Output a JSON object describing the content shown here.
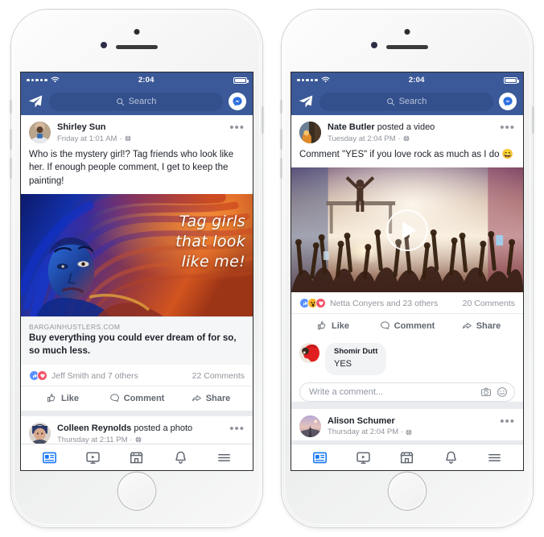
{
  "phones": [
    {
      "id": "phone-left",
      "status_bar": {
        "time": "2:04",
        "signal_dots": 5,
        "wifi": "wifi-icon",
        "battery": "battery-full-icon"
      },
      "nav_bar": {
        "left_icon": "paper-plane-icon",
        "search_placeholder": "Search",
        "search_icon": "search-icon",
        "right_icon": "messenger-icon"
      },
      "posts": [
        {
          "author": "Shirley Sun",
          "action": "",
          "timestamp": "Friday at 1:01 AM",
          "privacy_icon": "globe-icon",
          "menu_icon": "ellipsis-icon",
          "text": "Who is the mystery girl!? Tag friends who look like her. If enough people comment, I get to keep the painting!",
          "media_type": "image",
          "image_caption": "Tag girls\nthat look\nlike me!",
          "image_alt": "painting of a woman with flowing blue and orange hair",
          "link": {
            "domain": "BARGAINHUSTLERS.COM",
            "title": "Buy everything you could ever dream of for so, so much less."
          },
          "reactions": [
            "like",
            "love"
          ],
          "reaction_text": "Jeff Smith and 7 others",
          "comments_count": "22 Comments",
          "actions": [
            {
              "label": "Like",
              "icon": "thumbs-up-icon"
            },
            {
              "label": "Comment",
              "icon": "comment-bubble-icon"
            },
            {
              "label": "Share",
              "icon": "share-arrow-icon"
            }
          ]
        },
        {
          "author": "Colleen Reynolds",
          "action": "posted a photo",
          "timestamp": "Thursday at 2:11 PM",
          "privacy_icon": "globe-icon",
          "menu_icon": "ellipsis-icon"
        }
      ],
      "tab_bar": [
        {
          "name": "news-feed",
          "icon": "news-feed-icon",
          "active": true
        },
        {
          "name": "watch",
          "icon": "video-screen-icon",
          "active": false
        },
        {
          "name": "marketplace",
          "icon": "storefront-icon",
          "active": false
        },
        {
          "name": "notifications",
          "icon": "bell-icon",
          "active": false
        },
        {
          "name": "menu",
          "icon": "hamburger-menu-icon",
          "active": false
        }
      ]
    },
    {
      "id": "phone-right",
      "status_bar": {
        "time": "2:04",
        "signal_dots": 5,
        "wifi": "wifi-icon",
        "battery": "battery-full-icon"
      },
      "nav_bar": {
        "left_icon": "paper-plane-icon",
        "search_placeholder": "Search",
        "search_icon": "search-icon",
        "right_icon": "messenger-icon"
      },
      "posts": [
        {
          "author": "Nate Butler",
          "action": "posted a video",
          "timestamp": "Tuesday at 2:04 PM",
          "privacy_icon": "globe-icon",
          "menu_icon": "ellipsis-icon",
          "text": "Comment \"YES\" if you love rock as much as I do 😄",
          "media_type": "video",
          "video_alt": "concert crowd with raised hands and stage lights",
          "play_icon": "play-button-icon",
          "reactions": [
            "like",
            "wow",
            "love"
          ],
          "reaction_text": "Netta Conyers and 23 others",
          "comments_count": "20 Comments",
          "actions": [
            {
              "label": "Like",
              "icon": "thumbs-up-icon"
            },
            {
              "label": "Comment",
              "icon": "comment-bubble-icon"
            },
            {
              "label": "Share",
              "icon": "share-arrow-icon"
            }
          ],
          "comment": {
            "author": "Shomir Dutt",
            "body": "YES"
          },
          "composer": {
            "placeholder": "Write a comment...",
            "camera_icon": "camera-icon",
            "sticker_icon": "smiley-face-icon"
          }
        },
        {
          "author": "Alison Schumer",
          "action": "",
          "timestamp": "Thursday at 2:04 PM",
          "privacy_icon": "globe-icon",
          "menu_icon": "ellipsis-icon"
        }
      ],
      "tab_bar": [
        {
          "name": "news-feed",
          "icon": "news-feed-icon",
          "active": true
        },
        {
          "name": "watch",
          "icon": "video-screen-icon",
          "active": false
        },
        {
          "name": "marketplace",
          "icon": "storefront-icon",
          "active": false
        },
        {
          "name": "notifications",
          "icon": "bell-icon",
          "active": false
        },
        {
          "name": "menu",
          "icon": "hamburger-menu-icon",
          "active": false
        }
      ]
    }
  ],
  "colors": {
    "facebook_blue": "#3b5998",
    "search_field": "#33508c",
    "feed_background": "#e9ebee",
    "text_primary": "#1d2129",
    "text_secondary": "#90949c",
    "action_text": "#616770",
    "like_blue": "#5890ff",
    "love_red": "#f25268",
    "wow_yellow": "#f7b125",
    "active_tab_blue": "#1877f2"
  }
}
